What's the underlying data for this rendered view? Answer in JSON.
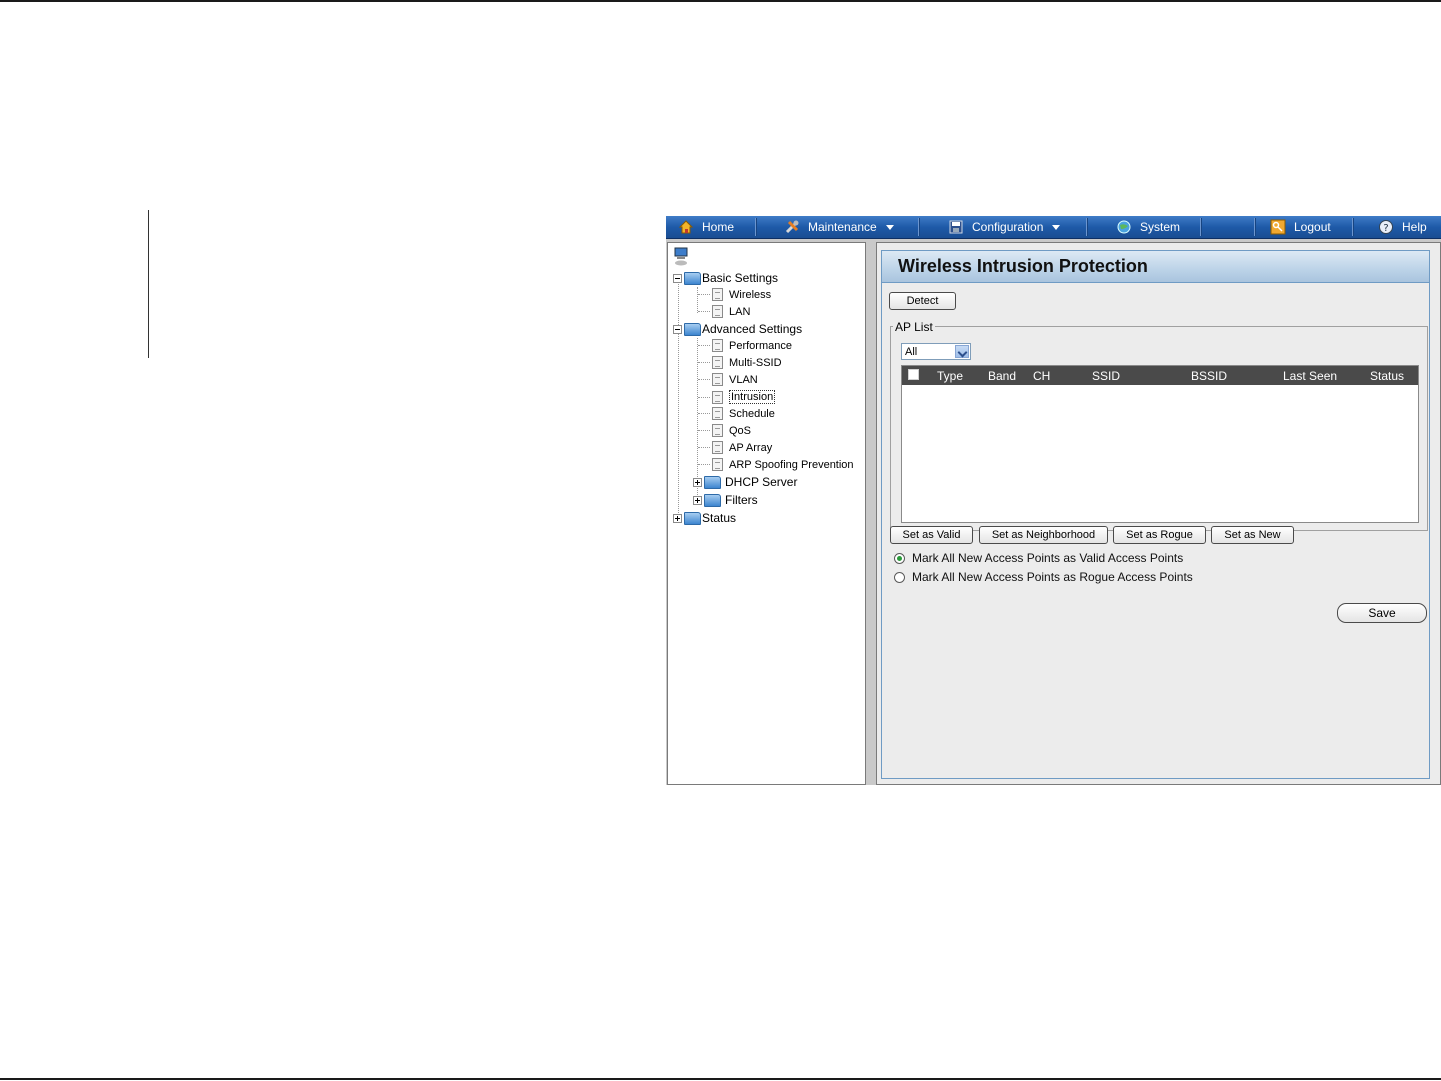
{
  "menu": {
    "home": "Home",
    "maintenance": "Maintenance",
    "configuration": "Configuration",
    "system": "System",
    "logout": "Logout",
    "help": "Help"
  },
  "tree": {
    "basic_settings": "Basic Settings",
    "wireless": "Wireless",
    "lan": "LAN",
    "advanced_settings": "Advanced Settings",
    "performance": "Performance",
    "multi_ssid": "Multi-SSID",
    "vlan": "VLAN",
    "intrusion": "Intrusion",
    "schedule": "Schedule",
    "qos": "QoS",
    "ap_array": "AP Array",
    "arp_spoofing": "ARP Spoofing Prevention",
    "dhcp_server": "DHCP Server",
    "filters": "Filters",
    "status": "Status"
  },
  "panel": {
    "title": "Wireless Intrusion Protection",
    "detect": "Detect",
    "ap_list_legend": "AP List",
    "filter_value": "All",
    "columns": [
      "Type",
      "Band",
      "CH",
      "SSID",
      "BSSID",
      "Last Seen",
      "Status"
    ],
    "buttons": {
      "set_valid": "Set as Valid",
      "set_neighborhood": "Set as Neighborhood",
      "set_rogue": "Set as Rogue",
      "set_new": "Set as New"
    },
    "radio_valid": "Mark All New Access Points as Valid Access Points",
    "radio_rogue": "Mark All New Access Points as Rogue Access Points",
    "save": "Save"
  }
}
